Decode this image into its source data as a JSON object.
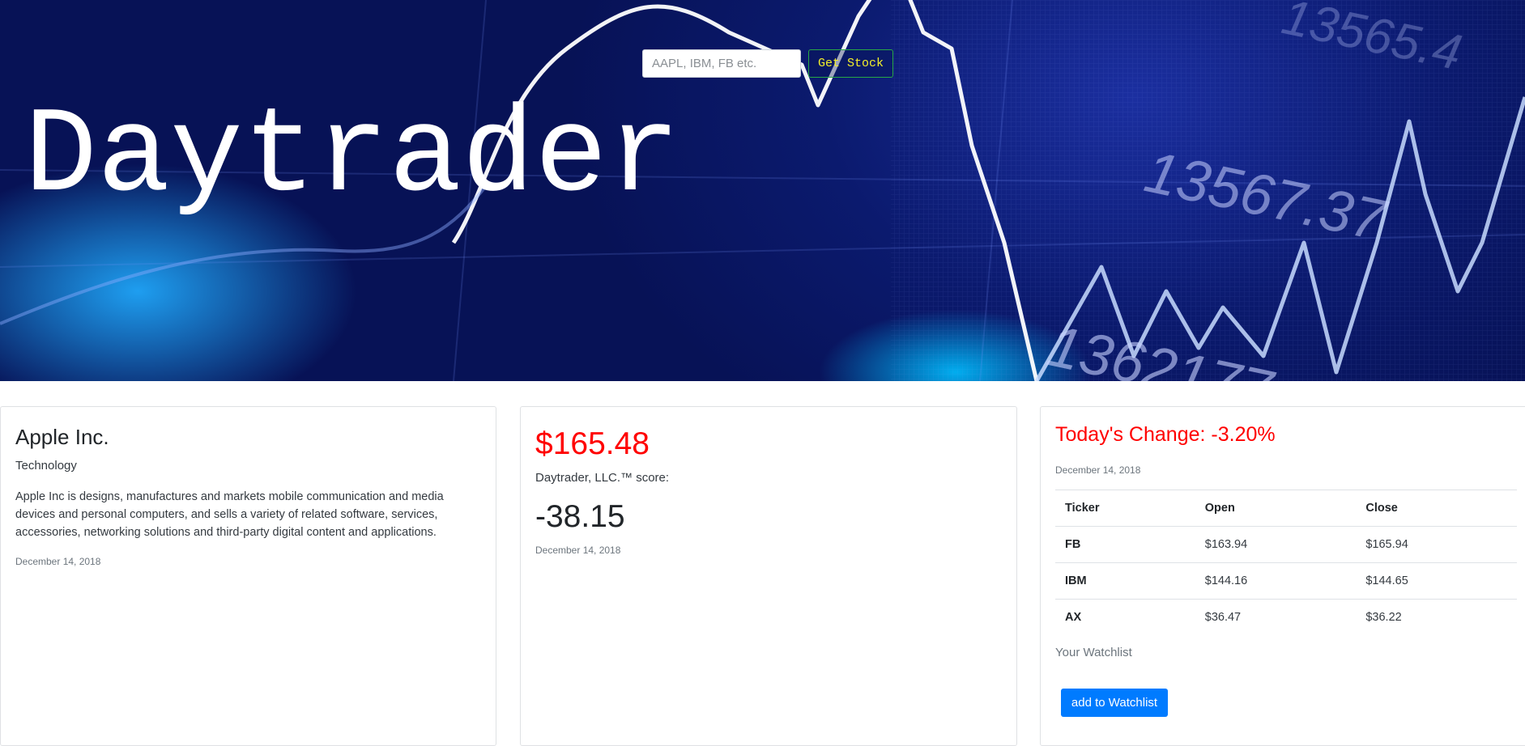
{
  "search": {
    "placeholder": "AAPL, IBM, FB etc.",
    "button_label": "Get Stock"
  },
  "hero": {
    "title": "Daytrader"
  },
  "company": {
    "name": "Apple Inc.",
    "sector": "Technology",
    "description": "Apple Inc is designs, manufactures and markets mobile communication and media devices and personal computers, and sells a variety of related software, services, accessories, networking solutions and third-party digital content and applications.",
    "date": "December 14, 2018"
  },
  "quote": {
    "price": "$165.48",
    "score_label": "Daytrader, LLC.™ score:",
    "score": "-38.15",
    "date": "December 14, 2018"
  },
  "change": {
    "title": "Today's Change: -3.20%",
    "date": "December 14, 2018"
  },
  "watchlist": {
    "headers": [
      "Ticker",
      "Open",
      "Close"
    ],
    "rows": [
      {
        "ticker": "FB",
        "open": "$163.94",
        "close": "$165.94"
      },
      {
        "ticker": "IBM",
        "open": "$144.16",
        "close": "$144.65"
      },
      {
        "ticker": "AX",
        "open": "$36.47",
        "close": "$36.22"
      }
    ],
    "label": "Your Watchlist",
    "add_button": "add to Watchlist"
  },
  "colors": {
    "accent": "#007bff",
    "negative": "#ff0000",
    "hero_bg": "#0b1a6e",
    "get_stock_text": "#f4f02a"
  }
}
